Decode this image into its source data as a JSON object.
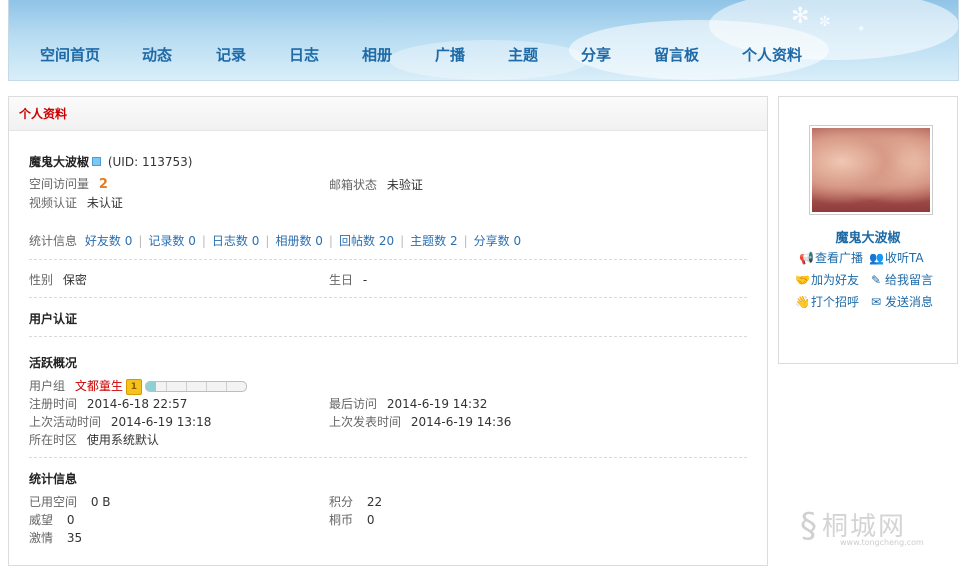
{
  "header": {
    "top_sliver": "",
    "nav": [
      {
        "label": "空间首页"
      },
      {
        "label": "动态"
      },
      {
        "label": "记录"
      },
      {
        "label": "日志"
      },
      {
        "label": "相册"
      },
      {
        "label": "广播"
      },
      {
        "label": "主题"
      },
      {
        "label": "分享"
      },
      {
        "label": "留言板"
      },
      {
        "label": "个人资料"
      }
    ]
  },
  "main": {
    "title": "个人资料",
    "profile": {
      "username": "魔鬼大波椒",
      "uid": "(UID: 113753)",
      "visits_label": "空间访问量",
      "visits_value": "2",
      "email_label": "邮箱状态",
      "email_value": "未验证",
      "video_label": "视频认证",
      "video_value": "未认证"
    },
    "stats_bar": {
      "label": "统计信息",
      "items": [
        {
          "label": "好友数",
          "value": "0"
        },
        {
          "label": "记录数",
          "value": "0"
        },
        {
          "label": "日志数",
          "value": "0"
        },
        {
          "label": "相册数",
          "value": "0"
        },
        {
          "label": "回帖数",
          "value": "20"
        },
        {
          "label": "主题数",
          "value": "2"
        },
        {
          "label": "分享数",
          "value": "0"
        }
      ]
    },
    "gender_label": "性别",
    "gender_value": "保密",
    "birthday_label": "生日",
    "birthday_value": "-",
    "cert_heading": "用户认证",
    "activity": {
      "heading": "活跃概况",
      "group_label": "用户组",
      "group_value": "文都童生",
      "group_progress": 0.1,
      "reg_label": "注册时间",
      "reg_value": "2014-6-18 22:57",
      "last_visit_label": "最后访问",
      "last_visit_value": "2014-6-19 14:32",
      "last_active_label": "上次活动时间",
      "last_active_value": "2014-6-19 13:18",
      "last_post_label": "上次发表时间",
      "last_post_value": "2014-6-19 14:36",
      "tz_label": "所在时区",
      "tz_value": "使用系统默认"
    },
    "stats": {
      "heading": "统计信息",
      "space_label": "已用空间",
      "space_value": "0 B",
      "points_label": "积分",
      "points_value": "22",
      "prestige_label": "威望",
      "prestige_value": "0",
      "coins_label": "桐币",
      "coins_value": "0",
      "passion_label": "激情",
      "passion_value": "35"
    }
  },
  "sidebar": {
    "name": "魔鬼大波椒",
    "actions": [
      {
        "label": "查看广播",
        "icon": "megaphone-icon"
      },
      {
        "label": "收听TA",
        "icon": "users-icon"
      },
      {
        "label": "加为好友",
        "icon": "handshake-icon"
      },
      {
        "label": "给我留言",
        "icon": "pencil-icon"
      },
      {
        "label": "打个招呼",
        "icon": "wave-icon"
      },
      {
        "label": "发送消息",
        "icon": "envelope-icon"
      }
    ]
  },
  "watermark": {
    "text": "桐城网",
    "url": "www.tongcheng.com"
  },
  "colors": {
    "nav_link": "#1e6aa7",
    "title_red": "#cc0000",
    "link_blue": "#2a6fb0",
    "accent_orange": "#e27d20"
  }
}
